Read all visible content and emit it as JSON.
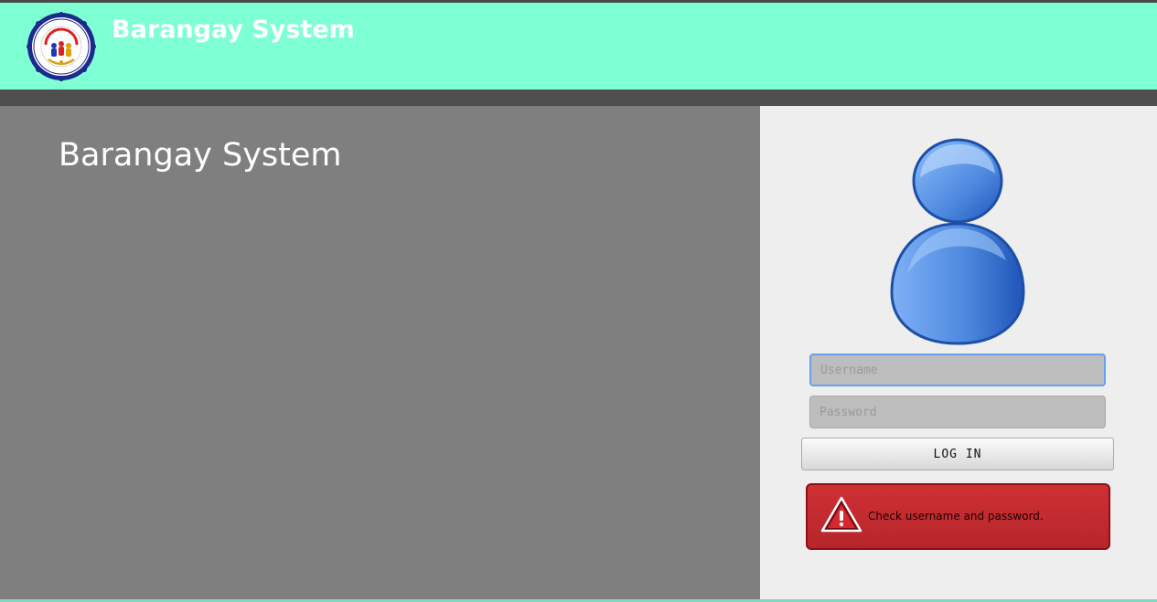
{
  "header": {
    "title": "Barangay System",
    "logo_icon": "barangay-seal-icon"
  },
  "main": {
    "title": "Barangay System"
  },
  "login": {
    "avatar_icon": "user-avatar-icon",
    "username_placeholder": "Username",
    "password_placeholder": "Password",
    "login_label": "LOG IN",
    "error_message": "Check username and password.",
    "error_icon": "warning-triangle-icon"
  },
  "colors": {
    "header_bg": "#7fffd4",
    "left_panel_bg": "#7f7f7f",
    "right_panel_bg": "#eeeeee",
    "alert_bg": "#c1292e"
  }
}
